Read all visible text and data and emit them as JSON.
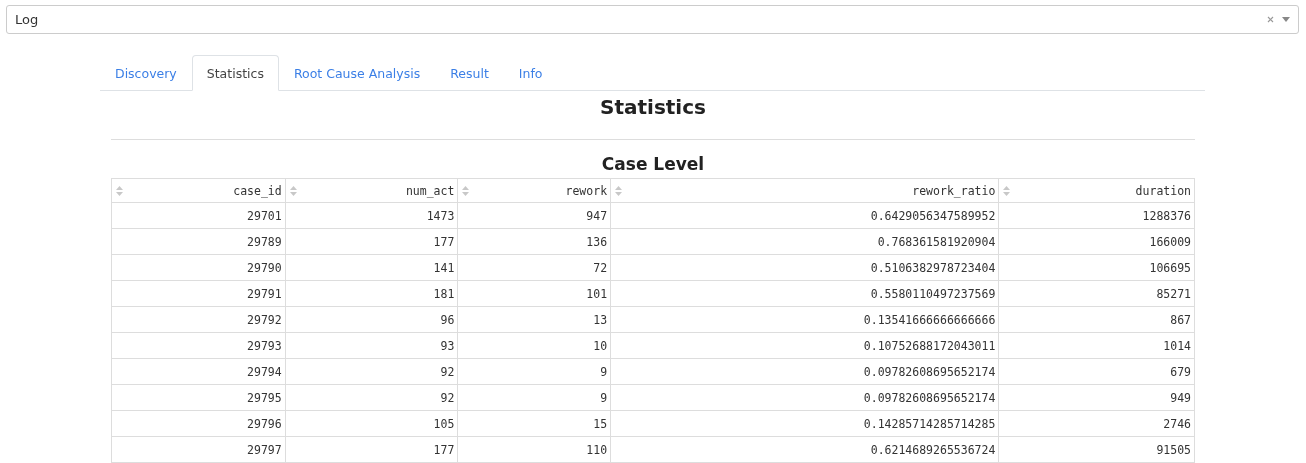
{
  "log_select": {
    "value": "Log"
  },
  "tabs": [
    {
      "label": "Discovery",
      "selected": false
    },
    {
      "label": "Statistics",
      "selected": true
    },
    {
      "label": "Root Cause Analysis",
      "selected": false
    },
    {
      "label": "Result",
      "selected": false
    },
    {
      "label": "Info",
      "selected": false
    }
  ],
  "title": "Statistics",
  "section_title": "Case Level",
  "table": {
    "columns": [
      "case_id",
      "num_act",
      "rework",
      "rework_ratio",
      "duration"
    ],
    "rows": [
      [
        "29701",
        "1473",
        "947",
        "0.6429056347589952",
        "1288376"
      ],
      [
        "29789",
        "177",
        "136",
        "0.768361581920904",
        "166009"
      ],
      [
        "29790",
        "141",
        "72",
        "0.5106382978723404",
        "106695"
      ],
      [
        "29791",
        "181",
        "101",
        "0.5580110497237569",
        "85271"
      ],
      [
        "29792",
        "96",
        "13",
        "0.13541666666666666",
        "867"
      ],
      [
        "29793",
        "93",
        "10",
        "0.10752688172043011",
        "1014"
      ],
      [
        "29794",
        "92",
        "9",
        "0.09782608695652174",
        "679"
      ],
      [
        "29795",
        "92",
        "9",
        "0.09782608695652174",
        "949"
      ],
      [
        "29796",
        "105",
        "15",
        "0.14285714285714285",
        "2746"
      ],
      [
        "29797",
        "177",
        "110",
        "0.6214689265536724",
        "91505"
      ]
    ]
  }
}
